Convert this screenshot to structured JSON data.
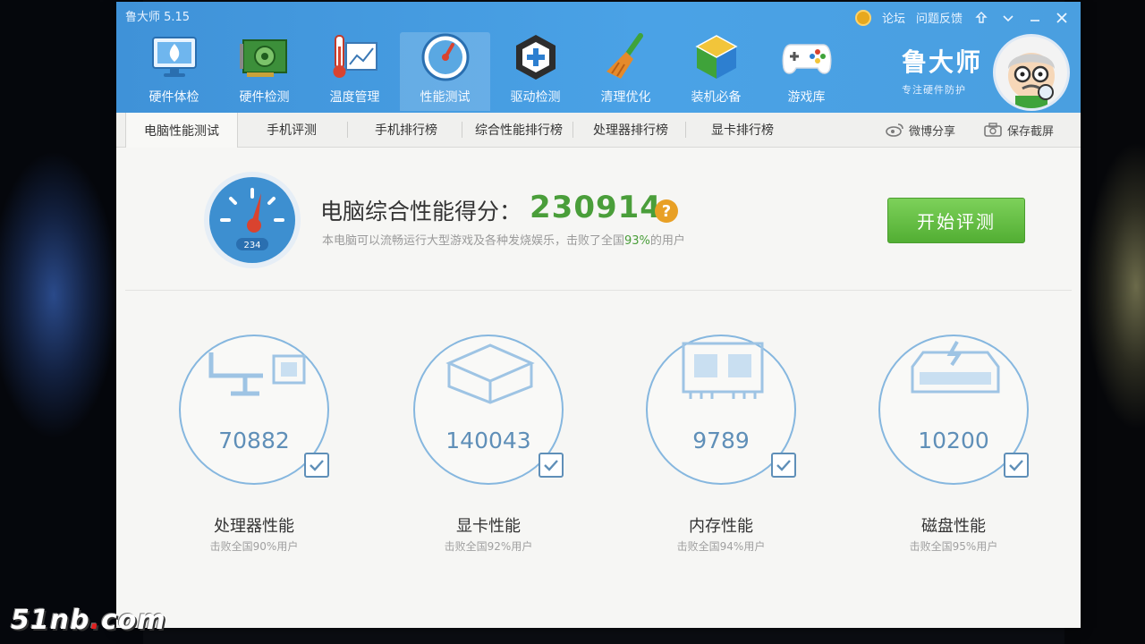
{
  "window": {
    "title": "鲁大师 5.15"
  },
  "title_links": {
    "forum": "论坛",
    "feedback": "问题反馈"
  },
  "nav": [
    {
      "label": "硬件体检",
      "icon": "monitor-check-icon"
    },
    {
      "label": "硬件检测",
      "icon": "circuit-board-icon"
    },
    {
      "label": "温度管理",
      "icon": "thermometer-chart-icon"
    },
    {
      "label": "性能测试",
      "icon": "speed-gauge-icon",
      "active": true
    },
    {
      "label": "驱动检测",
      "icon": "driver-gear-icon"
    },
    {
      "label": "清理优化",
      "icon": "broom-icon"
    },
    {
      "label": "装机必备",
      "icon": "cube-package-icon"
    },
    {
      "label": "游戏库",
      "icon": "gamepad-icon"
    }
  ],
  "brand": {
    "name": "鲁大师",
    "slogan": "专注硬件防护"
  },
  "tabs": [
    "电脑性能测试",
    "手机评测",
    "手机排行榜",
    "综合性能排行榜",
    "处理器排行榜",
    "显卡排行榜"
  ],
  "actions": {
    "weibo_share": "微博分享",
    "save_screenshot": "保存截屏"
  },
  "summary": {
    "title": "电脑综合性能得分：",
    "score": "230914",
    "help": "?",
    "desc_prefix": "本电脑可以流畅运行大型游戏及各种发烧娱乐，击败了全国",
    "desc_pct": "93%",
    "desc_suffix": "的用户",
    "gauge_number": "234"
  },
  "start_button": "开始评测",
  "components": [
    {
      "score": "70882",
      "label": "处理器性能",
      "sub": "击败全国90%用户",
      "icon": "cpu-monitor-icon"
    },
    {
      "score": "140043",
      "label": "显卡性能",
      "sub": "击败全国92%用户",
      "icon": "graphics-box-icon"
    },
    {
      "score": "9789",
      "label": "内存性能",
      "sub": "击败全国94%用户",
      "icon": "memory-chip-icon"
    },
    {
      "score": "10200",
      "label": "磁盘性能",
      "sub": "击败全国95%用户",
      "icon": "disk-drive-icon"
    }
  ],
  "colors": {
    "header_blue": "#4aa2e6",
    "score_green": "#4a9e3a",
    "ring_blue": "#86b7df",
    "button_green": "#52ae33"
  },
  "watermark": {
    "left": "51nb",
    "dot": ".",
    "right": "com"
  }
}
